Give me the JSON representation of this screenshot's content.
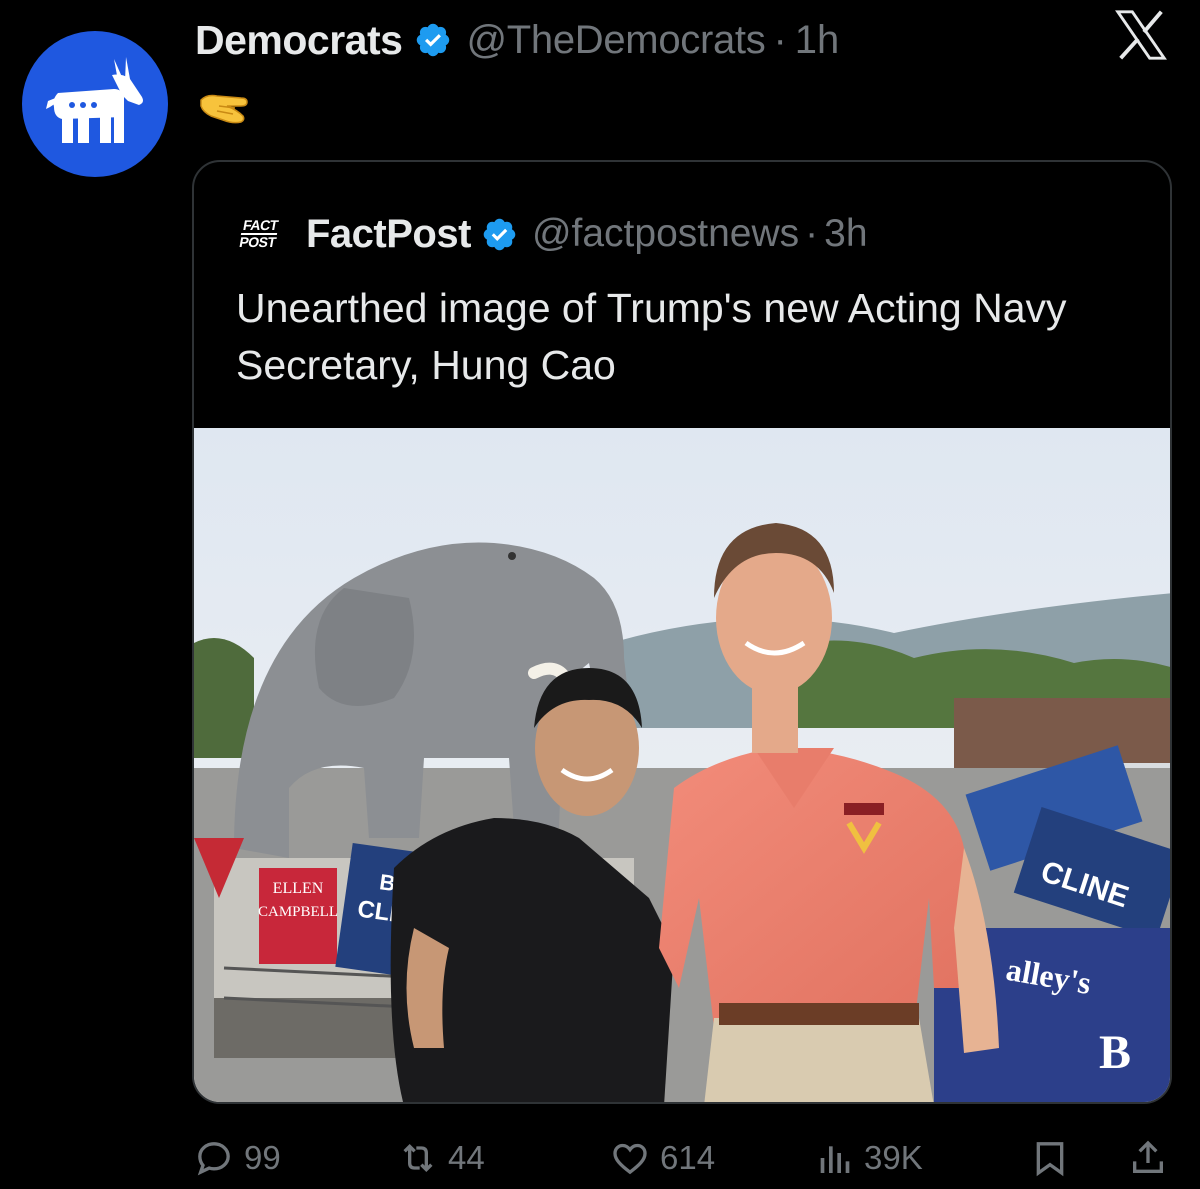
{
  "post": {
    "author_name": "Democrats",
    "author_handle": "@TheDemocrats",
    "separator": "·",
    "time": "1h",
    "emoji": "🫳",
    "avatar_icon": "donkey-logo-icon",
    "verified_icon": "verified-badge-icon"
  },
  "quoted_post": {
    "author_avatar_line1": "FACT",
    "author_avatar_line2": "POST",
    "author_name": "FactPost",
    "author_handle": "@factpostnews",
    "separator": "·",
    "time": "3h",
    "text": "Unearthed image of Trump's new Acting Navy Secretary, Hung Cao",
    "image_description_visible_text": {
      "sign_left": [
        "ELLEN",
        "CAMPBELL"
      ],
      "sign_middle": [
        "BEN",
        "CLIN"
      ],
      "sign_right": [
        "CLINE"
      ],
      "banner": [
        "alley's",
        "B"
      ]
    }
  },
  "actions": {
    "replies": "99",
    "reposts": "44",
    "likes": "614",
    "views": "39K"
  },
  "colors": {
    "background": "#000000",
    "text_primary": "#e7e9ea",
    "text_secondary": "#71767b",
    "border": "#2f3336",
    "verified": "#1d9bf0",
    "avatar_bg": "#1f58e0"
  },
  "icons": {
    "x": "x-logo-icon",
    "reply": "reply-icon",
    "repost": "repost-icon",
    "like": "heart-icon",
    "views": "views-icon",
    "bookmark": "bookmark-icon",
    "share": "share-icon"
  }
}
